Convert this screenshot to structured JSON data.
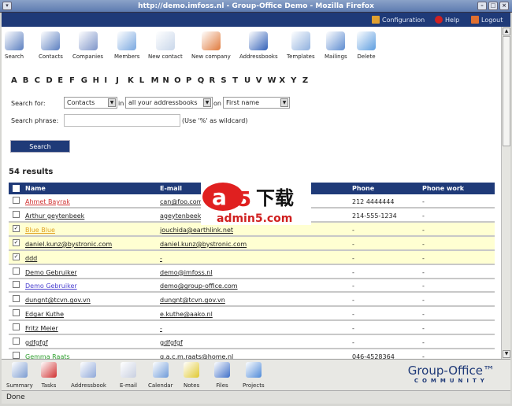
{
  "window": {
    "title": "http://demo.imfoss.nl - Group-Office Demo - Mozilla Firefox"
  },
  "header": {
    "configuration": "Configuration",
    "help": "Help",
    "logout": "Logout"
  },
  "toolbar": [
    {
      "label": "Search",
      "icon": "search-icon",
      "color": "#5b7fc0"
    },
    {
      "label": "Contacts",
      "icon": "contacts-icon",
      "color": "#5b7fc0"
    },
    {
      "label": "Companies",
      "icon": "companies-icon",
      "color": "#7e95c9"
    },
    {
      "label": "Members",
      "icon": "members-icon",
      "color": "#7aa8e0"
    },
    {
      "label": "New contact",
      "icon": "new-contact-icon",
      "color": "#c9d7ea"
    },
    {
      "label": "New company",
      "icon": "new-company-icon",
      "color": "#e07a3c"
    },
    {
      "label": "Addressbooks",
      "icon": "addressbooks-icon",
      "color": "#3361b8"
    },
    {
      "label": "Templates",
      "icon": "templates-icon",
      "color": "#8fb0de"
    },
    {
      "label": "Mailings",
      "icon": "mailings-icon",
      "color": "#5d8cd0"
    },
    {
      "label": "Delete",
      "icon": "delete-icon",
      "color": "#5d9ee0"
    }
  ],
  "letters": [
    "A",
    "B",
    "C",
    "D",
    "E",
    "F",
    "G",
    "H",
    "I",
    "J",
    "K",
    "L",
    "M",
    "N",
    "O",
    "P",
    "Q",
    "R",
    "S",
    "T",
    "U",
    "V",
    "W",
    "X",
    "Y",
    "Z"
  ],
  "search": {
    "search_for_label": "Search for:",
    "type": "Contacts",
    "in_label": "in",
    "addressbook": "all your addressbooks",
    "on_label": "on",
    "field": "First name",
    "phrase_label": "Search phrase:",
    "phrase_value": "",
    "wildcard_hint": "(Use '%' as wildcard)",
    "button": "Search"
  },
  "results": "54 results",
  "table": {
    "headers": [
      "Name",
      "E-mail",
      "Phone",
      "Phone work"
    ],
    "rows": [
      {
        "name": "Ahmet Bayrak",
        "email": "can@foo.com",
        "phone": "212 4444444",
        "phone_work": "-",
        "checked": false,
        "color": "#d03030"
      },
      {
        "name": "Arthur geytenbeek",
        "email": "ageytenbeek",
        "phone": "214-555-1234",
        "phone_work": "-",
        "checked": false,
        "color": "#222222"
      },
      {
        "name": "Blue Blue",
        "email": "jouchida@earthlink.net",
        "phone": "-",
        "phone_work": "-",
        "checked": true,
        "color": "#e0a020"
      },
      {
        "name": "daniel.kunz@bystronic.com",
        "email": "daniel.kunz@bystronic.com",
        "phone": "-",
        "phone_work": "-",
        "checked": true,
        "color": "#222222"
      },
      {
        "name": "ddd",
        "email": "-",
        "phone": "-",
        "phone_work": "-",
        "checked": true,
        "color": "#222222"
      },
      {
        "name": "Demo Gebruiker",
        "email": "demo@imfoss.nl",
        "phone": "-",
        "phone_work": "-",
        "checked": false,
        "color": "#222222"
      },
      {
        "name": "Demo Gebruiker",
        "email": "demo@group-office.com",
        "phone": "-",
        "phone_work": "-",
        "checked": false,
        "color": "#4a40d0"
      },
      {
        "name": "dungnt@tcvn.gov.vn",
        "email": "dungnt@tcvn.gov.vn",
        "phone": "-",
        "phone_work": "-",
        "checked": false,
        "color": "#222222"
      },
      {
        "name": "Edgar Kuthe",
        "email": "e.kuthe@aako.nl",
        "phone": "-",
        "phone_work": "-",
        "checked": false,
        "color": "#222222"
      },
      {
        "name": "Fritz Meier",
        "email": "-",
        "phone": "-",
        "phone_work": "-",
        "checked": false,
        "color": "#222222"
      },
      {
        "name": "gdfgfgf",
        "email": "gdfgfgf",
        "phone": "-",
        "phone_work": "-",
        "checked": false,
        "color": "#222222"
      },
      {
        "name": "Gemma Raats",
        "email": "g.a.c.m.raats@home.nl",
        "phone": "046-4528364",
        "phone_work": "-",
        "checked": false,
        "color": "#30a030"
      }
    ]
  },
  "watermark": {
    "brand": "a5下载",
    "site": "admin5.com"
  },
  "bottom_nav": [
    {
      "label": "Summary",
      "icon": "summary-icon",
      "color": "#7b9bd0"
    },
    {
      "label": "Tasks",
      "icon": "tasks-icon",
      "color": "#d03030"
    },
    {
      "label": "Addressbook",
      "icon": "addressbook-icon",
      "color": "#8fa8d8"
    },
    {
      "label": "E-mail",
      "icon": "email-icon",
      "color": "#c8cfe0"
    },
    {
      "label": "Calendar",
      "icon": "calendar-icon",
      "color": "#6e9ad8"
    },
    {
      "label": "Notes",
      "icon": "notes-icon",
      "color": "#e0c830"
    },
    {
      "label": "Files",
      "icon": "files-icon",
      "color": "#3f6fc8"
    },
    {
      "label": "Projects",
      "icon": "projects-icon",
      "color": "#4f8ad8"
    }
  ],
  "logo": {
    "name": "Group-Office™",
    "edition": "COMMUNITY"
  },
  "status": "Done"
}
